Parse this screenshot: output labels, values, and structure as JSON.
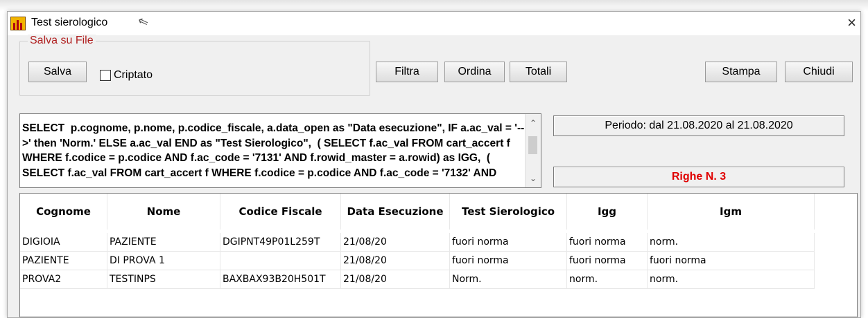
{
  "window": {
    "title": "Test sierologico",
    "close_icon": "×"
  },
  "save_group": {
    "title": "Salva su File",
    "save_label": "Salva",
    "encrypt_label": "Criptato",
    "encrypt_checked": false
  },
  "toolbar": {
    "filter_label": "Filtra",
    "sort_label": "Ordina",
    "totals_label": "Totali",
    "print_label": "Stampa",
    "close_label": "Chiudi"
  },
  "query": {
    "text": "SELECT  p.cognome, p.nome, p.codice_fiscale, a.data_open as \"Data esecuzione\", IF a.ac_val = '-->' then 'Norm.' ELSE a.ac_val END as \"Test Sierologico\",  ( SELECT f.ac_val FROM cart_accert f WHERE f.codice = p.codice AND f.ac_code = '7131' AND f.rowid_master = a.rowid) as IGG,  ( SELECT f.ac_val FROM cart_accert f WHERE f.codice = p.codice AND f.ac_code = '7132' AND"
  },
  "period": {
    "text": "Periodo: dal 21.08.2020 al 21.08.2020"
  },
  "rows_count": {
    "text": "Righe N. 3",
    "color": "#e00000"
  },
  "table": {
    "columns": [
      "Cognome",
      "Nome",
      "Codice Fiscale",
      "Data Esecuzione",
      "Test Sierologico",
      "Igg",
      "Igm"
    ],
    "rows": [
      [
        "DIGIOIA",
        "PAZIENTE",
        "DGIPNT49P01L259T",
        "21/08/20",
        "fuori norma",
        "fuori norma",
        "norm."
      ],
      [
        "PAZIENTE",
        "DI PROVA 1",
        "",
        "21/08/20",
        "fuori norma",
        "fuori norma",
        "fuori norma"
      ],
      [
        "PROVA2",
        "TESTINPS",
        "BAXBAX93B20H501T",
        "21/08/20",
        "Norm.",
        "norm.",
        "norm."
      ]
    ]
  }
}
